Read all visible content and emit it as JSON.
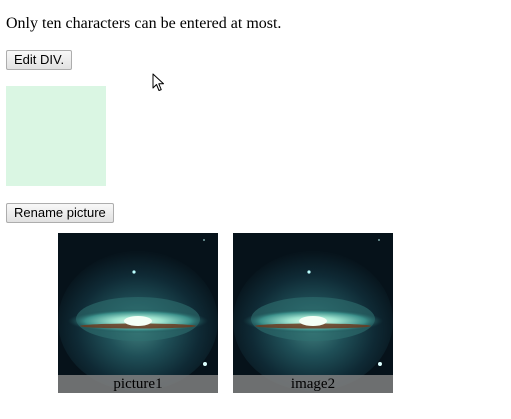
{
  "note_text": "Only ten characters can be entered at most.",
  "buttons": {
    "edit_label": "Edit DIV.",
    "rename_label": "Rename picture"
  },
  "edit_div": {
    "color": "#daf6e3"
  },
  "pictures": [
    {
      "caption": "picture1",
      "icon": "galaxy-image"
    },
    {
      "caption": "image2",
      "icon": "galaxy-image"
    }
  ],
  "cursor": {
    "icon": "mouse-pointer-icon"
  }
}
